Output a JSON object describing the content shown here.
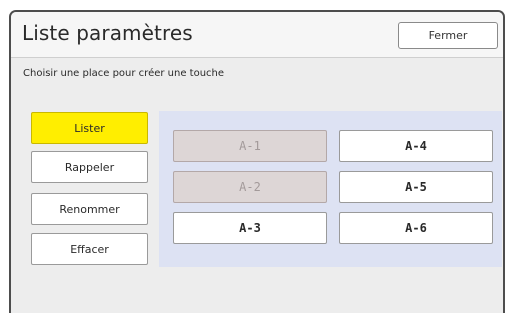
{
  "window": {
    "title": "Liste paramètres",
    "close_label": "Fermer"
  },
  "instruction": "Choisir une place pour créer une touche",
  "side_buttons": [
    {
      "label": "Lister",
      "active": true
    },
    {
      "label": "Rappeler",
      "active": false
    },
    {
      "label": "Renommer",
      "active": false
    },
    {
      "label": "Effacer",
      "active": false
    }
  ],
  "slots": [
    {
      "label": "A-1",
      "enabled": false
    },
    {
      "label": "A-2",
      "enabled": false
    },
    {
      "label": "A-3",
      "enabled": true
    },
    {
      "label": "A-4",
      "enabled": true
    },
    {
      "label": "A-5",
      "enabled": true
    },
    {
      "label": "A-6",
      "enabled": true
    }
  ],
  "colors": {
    "active_button": "#ffee00",
    "panel_background": "#dde2f3",
    "disabled_slot": "#ddd6d6"
  }
}
